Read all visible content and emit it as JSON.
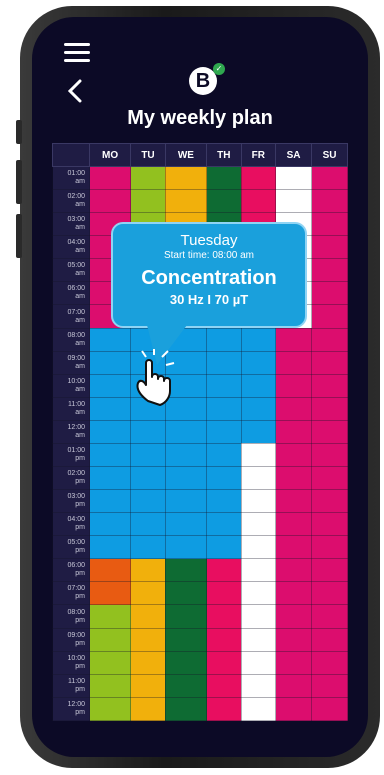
{
  "title": "My weekly plan",
  "logo_letter": "B",
  "days": [
    "MO",
    "TU",
    "WE",
    "TH",
    "FR",
    "SA",
    "SU"
  ],
  "times": [
    [
      "01:00",
      "am"
    ],
    [
      "02:00",
      "am"
    ],
    [
      "03:00",
      "am"
    ],
    [
      "04:00",
      "am"
    ],
    [
      "05:00",
      "am"
    ],
    [
      "06:00",
      "am"
    ],
    [
      "07:00",
      "am"
    ],
    [
      "08:00",
      "am"
    ],
    [
      "09:00",
      "am"
    ],
    [
      "10:00",
      "am"
    ],
    [
      "11:00",
      "am"
    ],
    [
      "12:00",
      "am"
    ],
    [
      "01:00",
      "pm"
    ],
    [
      "02:00",
      "pm"
    ],
    [
      "03:00",
      "pm"
    ],
    [
      "04:00",
      "pm"
    ],
    [
      "05:00",
      "pm"
    ],
    [
      "06:00",
      "pm"
    ],
    [
      "07:00",
      "pm"
    ],
    [
      "08:00",
      "pm"
    ],
    [
      "09:00",
      "pm"
    ],
    [
      "10:00",
      "pm"
    ],
    [
      "11:00",
      "pm"
    ],
    [
      "12:00",
      "pm"
    ]
  ],
  "colors": {
    "M": "#dc0d6e",
    "L": "#92c11f",
    "A": "#f1b00c",
    "G": "#0e6b33",
    "P": "#e80e60",
    "W": "#ffffff",
    "B": "#0e9ce2",
    "O": "#e85b12"
  },
  "schedule": [
    "MLAGPWM",
    "MLAGPWM",
    "MLAGPWM",
    "MLAGPWM",
    "MLAGPWM",
    "MLAGPWM",
    "MLAGPWM",
    "BBBBBMM",
    "BBBBBMM",
    "BBBBBMM",
    "BBBBBMM",
    "BBBBBMM",
    "BBBBWMM",
    "BBBBWMM",
    "BBBBWMM",
    "BBBBWMM",
    "BBBBWMM",
    "OAGPWMM",
    "OAGPWMM",
    "LAGPWMM",
    "LAGPWMM",
    "LAGPWMM",
    "LAGPWMM",
    "LAGPWMM"
  ],
  "popup": {
    "day": "Tuesday",
    "start_time": "Start time: 08:00 am",
    "program": "Concentration",
    "frequency": "30 Hz I 70 µT"
  }
}
